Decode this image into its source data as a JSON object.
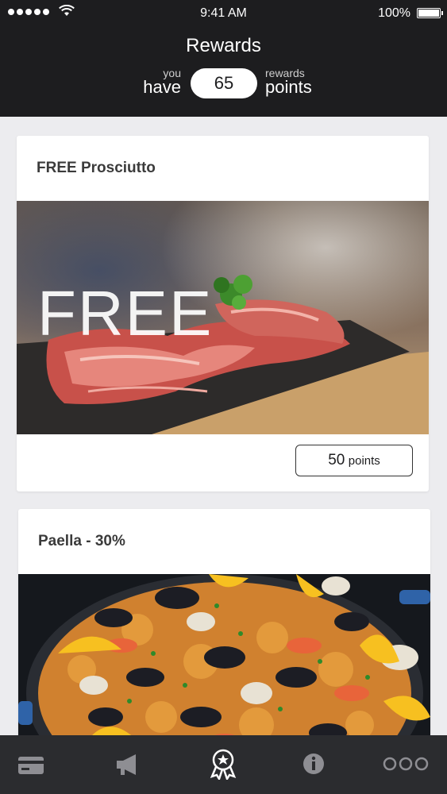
{
  "status_bar": {
    "time": "9:41 AM",
    "battery": "100%"
  },
  "header": {
    "title": "Rewards",
    "you": "you",
    "have": "have",
    "points_value": "65",
    "rewards": "rewards",
    "points": "points"
  },
  "cards": [
    {
      "title": "FREE Prosciutto",
      "image_overlay": "FREE",
      "points_value": "50",
      "points_unit": "points"
    },
    {
      "title": "Paella - 30%"
    }
  ],
  "tabbar": {
    "icons": [
      "card-icon",
      "megaphone-icon",
      "badge-icon",
      "info-icon",
      "more-icon"
    ],
    "active_index": 2
  },
  "colors": {
    "header_bg": "#1d1d1f",
    "page_bg": "#ececef",
    "tabbar_bg": "#2b2c2f",
    "tab_inactive": "#8e8e93",
    "tab_active": "#ffffff"
  }
}
